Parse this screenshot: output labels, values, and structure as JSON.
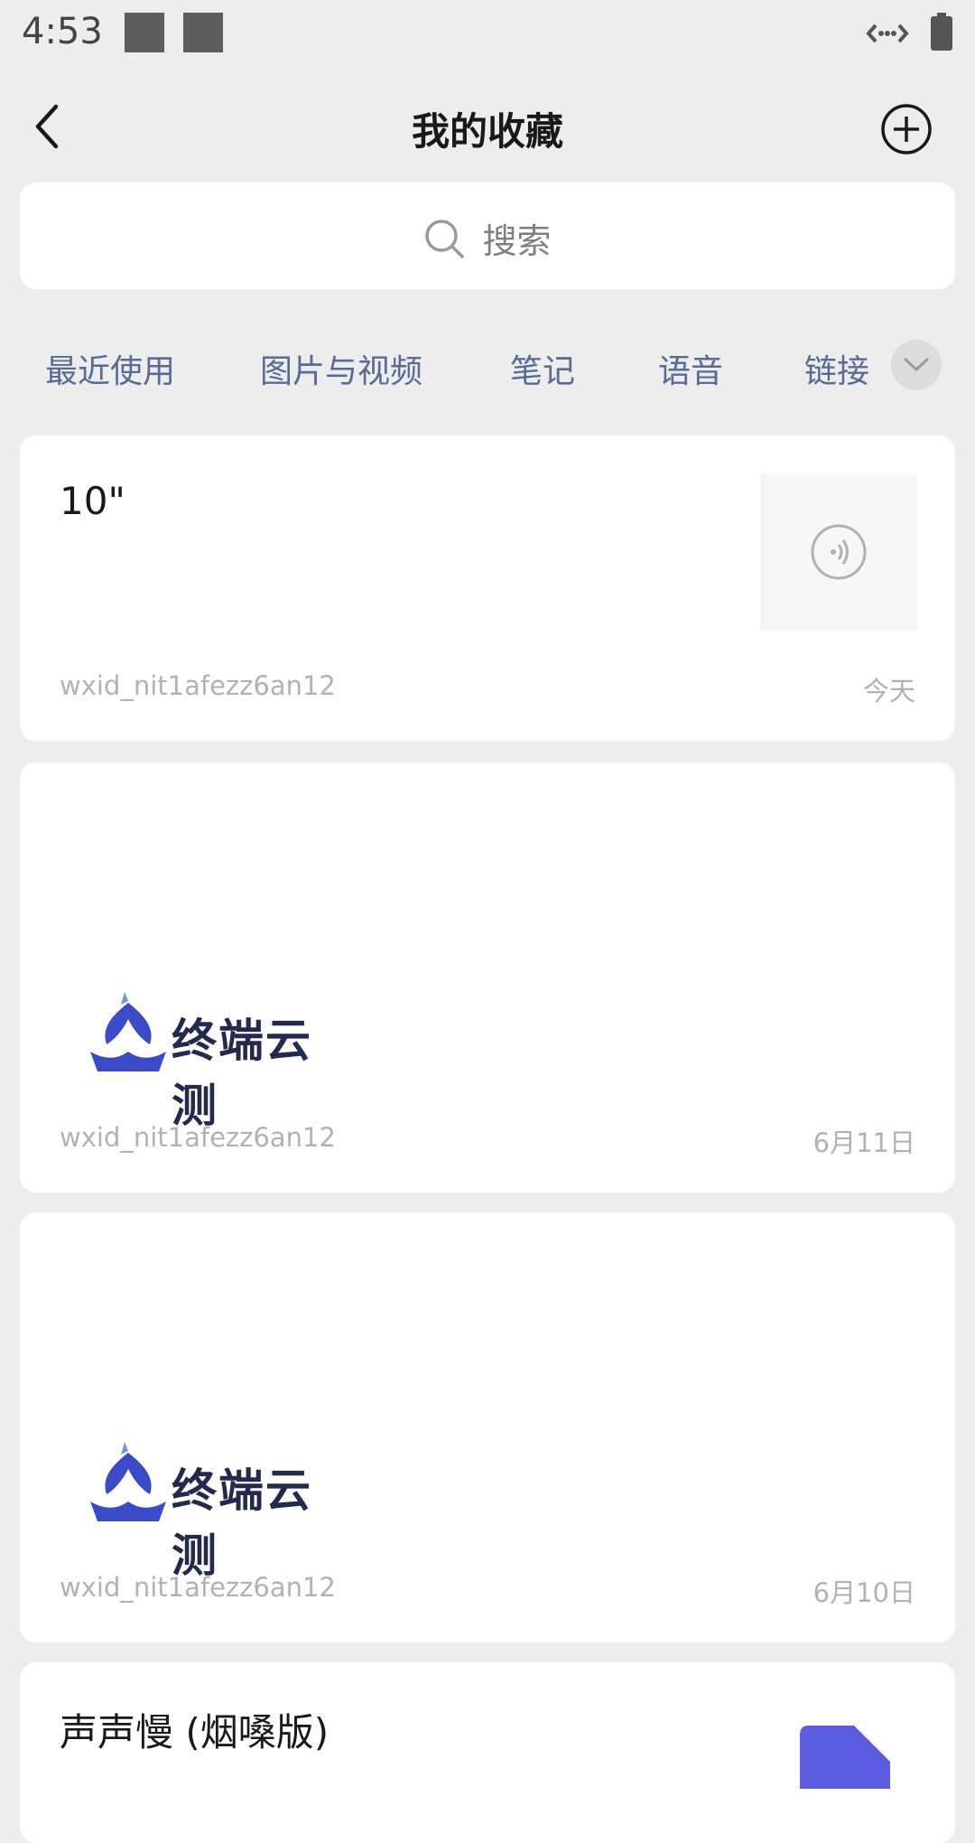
{
  "status_bar": {
    "time": "4:53"
  },
  "nav": {
    "title": "我的收藏"
  },
  "search": {
    "placeholder": "搜索"
  },
  "tabs": [
    "最近使用",
    "图片与视频",
    "笔记",
    "语音",
    "链接"
  ],
  "items": [
    {
      "type": "voice",
      "title": "10\"",
      "source": "wxid_nit1afezz6an12",
      "date": "今天"
    },
    {
      "type": "image",
      "logo_text": "终端云测",
      "source": "wxid_nit1afezz6an12",
      "date": "6月11日"
    },
    {
      "type": "image",
      "logo_text": "终端云测",
      "source": "wxid_nit1afezz6an12",
      "date": "6月10日"
    },
    {
      "type": "file",
      "title": "声声慢 (烟嗓版)"
    }
  ],
  "colors": {
    "accent_tab": "#576b95",
    "page_bg": "#ededed",
    "logo_blue": "#3b4bc8",
    "file_purple": "#5b5ce0"
  },
  "icons": [
    "back-arrow-icon",
    "add-circle-icon",
    "search-icon",
    "chevron-down-icon",
    "voice-icon",
    "file-icon"
  ]
}
